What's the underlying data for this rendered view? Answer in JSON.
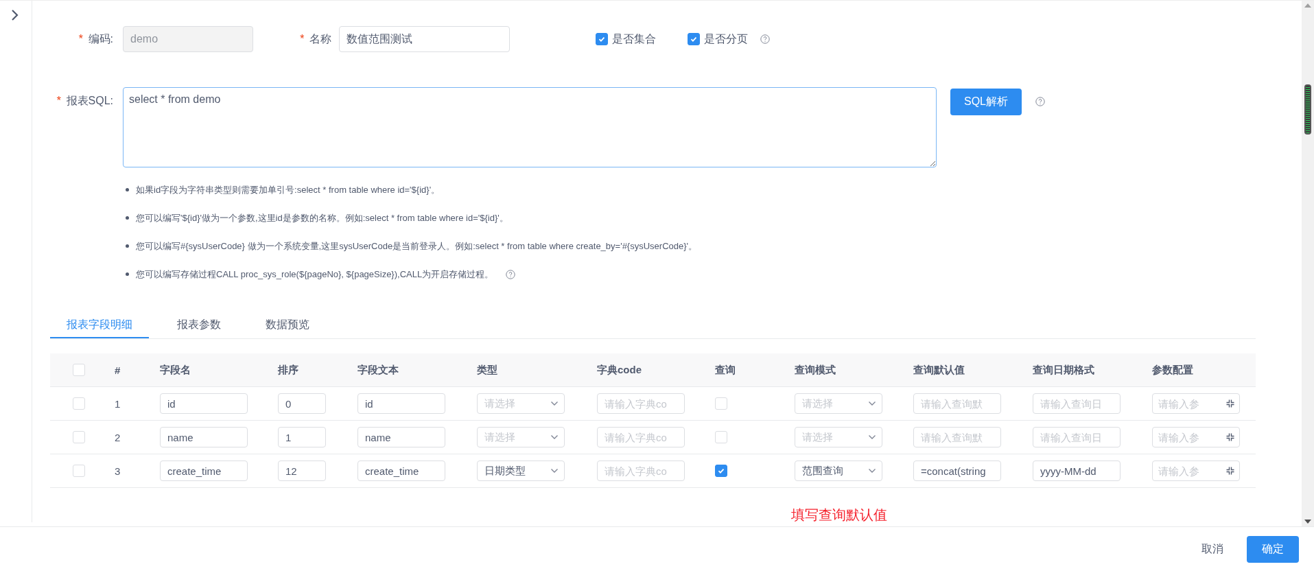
{
  "form": {
    "code": {
      "mark": "*",
      "label": "编码:",
      "value": "demo",
      "disabled": true
    },
    "name": {
      "mark": "*",
      "label": "名称",
      "value": "数值范围测试",
      "disabled": false
    },
    "options": [
      {
        "label": "是否集合",
        "checked": true,
        "help": false
      },
      {
        "label": "是否分页",
        "checked": true,
        "help": true
      }
    ],
    "sql": {
      "mark": "*",
      "label": "报表SQL:",
      "value": "select * from demo",
      "button": "SQL解析",
      "help": true
    },
    "hints": [
      {
        "text": "如果id字段为字符串类型则需要加单引号:select * from table where id='${id}'。",
        "help": false
      },
      {
        "text": "您可以编写'${id}'做为一个参数,这里id是参数的名称。例如:select * from table where id='${id}'。",
        "help": false
      },
      {
        "text": "您可以编写#{sysUserCode} 做为一个系统变量,这里sysUserCode是当前登录人。例如:select * from table where create_by='#{sysUserCode}'。",
        "help": false
      },
      {
        "text": "您可以编写存储过程CALL proc_sys_role(${pageNo}, ${pageSize}),CALL为开启存储过程。",
        "help": true
      }
    ]
  },
  "tabs": [
    {
      "label": "报表字段明细",
      "selected": true
    },
    {
      "label": "报表参数",
      "selected": false
    },
    {
      "label": "数据预览",
      "selected": false
    }
  ],
  "table": {
    "select_all": {
      "checked": false
    },
    "columns": [
      "#",
      "字段名",
      "排序",
      "字段文本",
      "类型",
      "字典code",
      "查询",
      "查询模式",
      "查询默认值",
      "查询日期格式",
      "参数配置"
    ],
    "rows": [
      {
        "selected": false,
        "cells": [
          {
            "kind": "text",
            "value": "1"
          },
          {
            "kind": "input",
            "value": "id"
          },
          {
            "kind": "number",
            "value": "0"
          },
          {
            "kind": "input",
            "value": "id"
          },
          {
            "kind": "select",
            "placeholder": "请选择"
          },
          {
            "kind": "input",
            "placeholder": "请输入字典co"
          },
          {
            "kind": "checkbox",
            "checked": false
          },
          {
            "kind": "select",
            "placeholder": "请选择"
          },
          {
            "kind": "input",
            "placeholder": "请输入查询默"
          },
          {
            "kind": "input",
            "placeholder": "请输入查询日"
          },
          {
            "kind": "config",
            "placeholder": "请输入参"
          }
        ]
      },
      {
        "selected": false,
        "cells": [
          {
            "kind": "text",
            "value": "2"
          },
          {
            "kind": "input",
            "value": "name"
          },
          {
            "kind": "number",
            "value": "1"
          },
          {
            "kind": "input",
            "value": "name"
          },
          {
            "kind": "select",
            "placeholder": "请选择"
          },
          {
            "kind": "input",
            "placeholder": "请输入字典co"
          },
          {
            "kind": "checkbox",
            "checked": false
          },
          {
            "kind": "select",
            "placeholder": "请选择"
          },
          {
            "kind": "input",
            "placeholder": "请输入查询默"
          },
          {
            "kind": "input",
            "placeholder": "请输入查询日"
          },
          {
            "kind": "config",
            "placeholder": "请输入参"
          }
        ]
      },
      {
        "selected": false,
        "cells": [
          {
            "kind": "text",
            "value": "3"
          },
          {
            "kind": "input",
            "value": "create_time"
          },
          {
            "kind": "number",
            "value": "12"
          },
          {
            "kind": "input",
            "value": "create_time"
          },
          {
            "kind": "select",
            "value": "日期类型"
          },
          {
            "kind": "input",
            "placeholder": "请输入字典co"
          },
          {
            "kind": "checkbox",
            "checked": true
          },
          {
            "kind": "select",
            "value": "范围查询"
          },
          {
            "kind": "input",
            "value": "=concat(string"
          },
          {
            "kind": "input",
            "value": "yyyy-MM-dd"
          },
          {
            "kind": "config",
            "placeholder": "请输入参"
          }
        ]
      }
    ]
  },
  "note": "填写查询默认值",
  "footer": {
    "cancel": "取消",
    "confirm": "确定"
  }
}
